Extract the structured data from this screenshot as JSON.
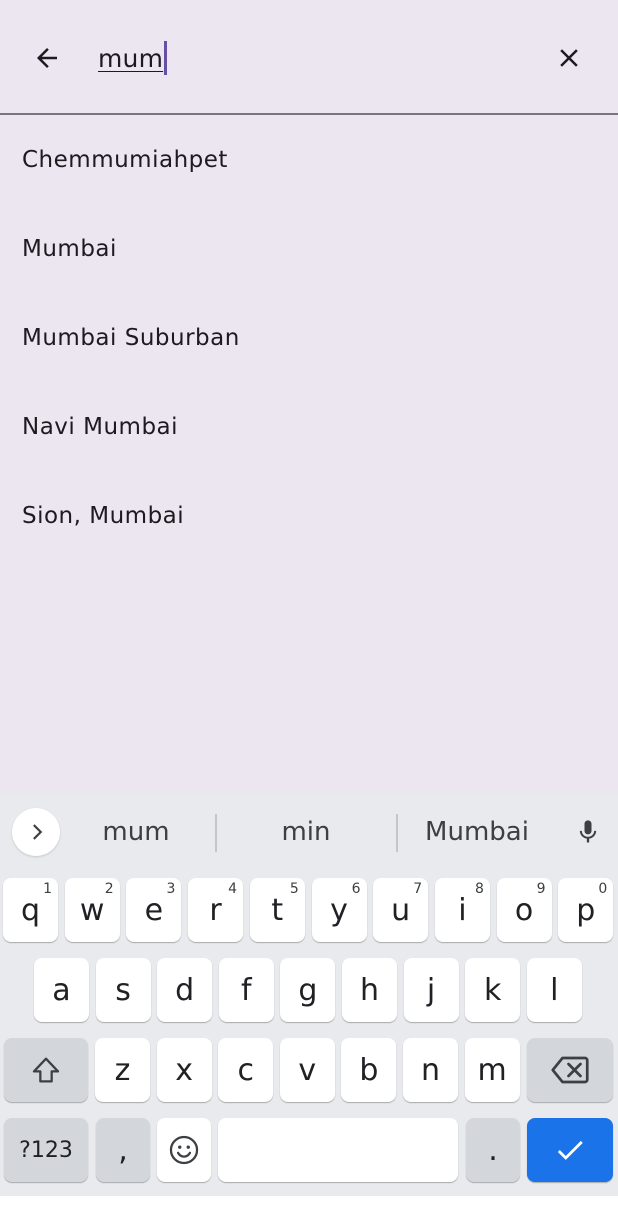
{
  "search": {
    "query": "mum",
    "back_icon": "arrow-back-icon",
    "clear_icon": "close-icon"
  },
  "results": [
    {
      "label": "Chemmumiahpet"
    },
    {
      "label": "Mumbai"
    },
    {
      "label": "Mumbai Suburban"
    },
    {
      "label": "Navi Mumbai"
    },
    {
      "label": "Sion, Mumbai"
    }
  ],
  "keyboard": {
    "suggestions": [
      "mum",
      "min",
      "Mumbai"
    ],
    "row1": [
      {
        "key": "q",
        "hint": "1"
      },
      {
        "key": "w",
        "hint": "2"
      },
      {
        "key": "e",
        "hint": "3"
      },
      {
        "key": "r",
        "hint": "4"
      },
      {
        "key": "t",
        "hint": "5"
      },
      {
        "key": "y",
        "hint": "6"
      },
      {
        "key": "u",
        "hint": "7"
      },
      {
        "key": "i",
        "hint": "8"
      },
      {
        "key": "o",
        "hint": "9"
      },
      {
        "key": "p",
        "hint": "0"
      }
    ],
    "row2": [
      "a",
      "s",
      "d",
      "f",
      "g",
      "h",
      "j",
      "k",
      "l"
    ],
    "row3": [
      "z",
      "x",
      "c",
      "v",
      "b",
      "n",
      "m"
    ],
    "symbols_label": "?123",
    "comma_label": ",",
    "period_label": ".",
    "accent_color": "#1a73e8"
  },
  "colors": {
    "background": "#ece6f0",
    "text": "#1d1b20",
    "caret": "#6750a4"
  }
}
